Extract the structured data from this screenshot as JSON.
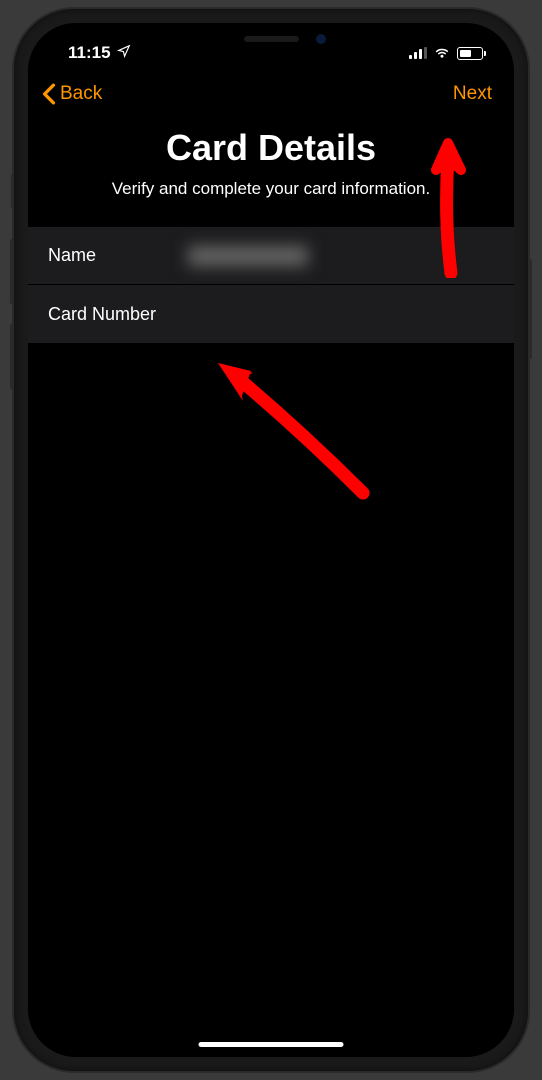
{
  "status_bar": {
    "time": "11:15"
  },
  "nav": {
    "back_label": "Back",
    "next_label": "Next"
  },
  "header": {
    "title": "Card Details",
    "subtitle": "Verify and complete your card information."
  },
  "form": {
    "name_label": "Name",
    "name_value": "",
    "card_number_label": "Card Number",
    "card_number_value": ""
  },
  "colors": {
    "accent": "#ff9500",
    "arrow": "#ff0000"
  }
}
